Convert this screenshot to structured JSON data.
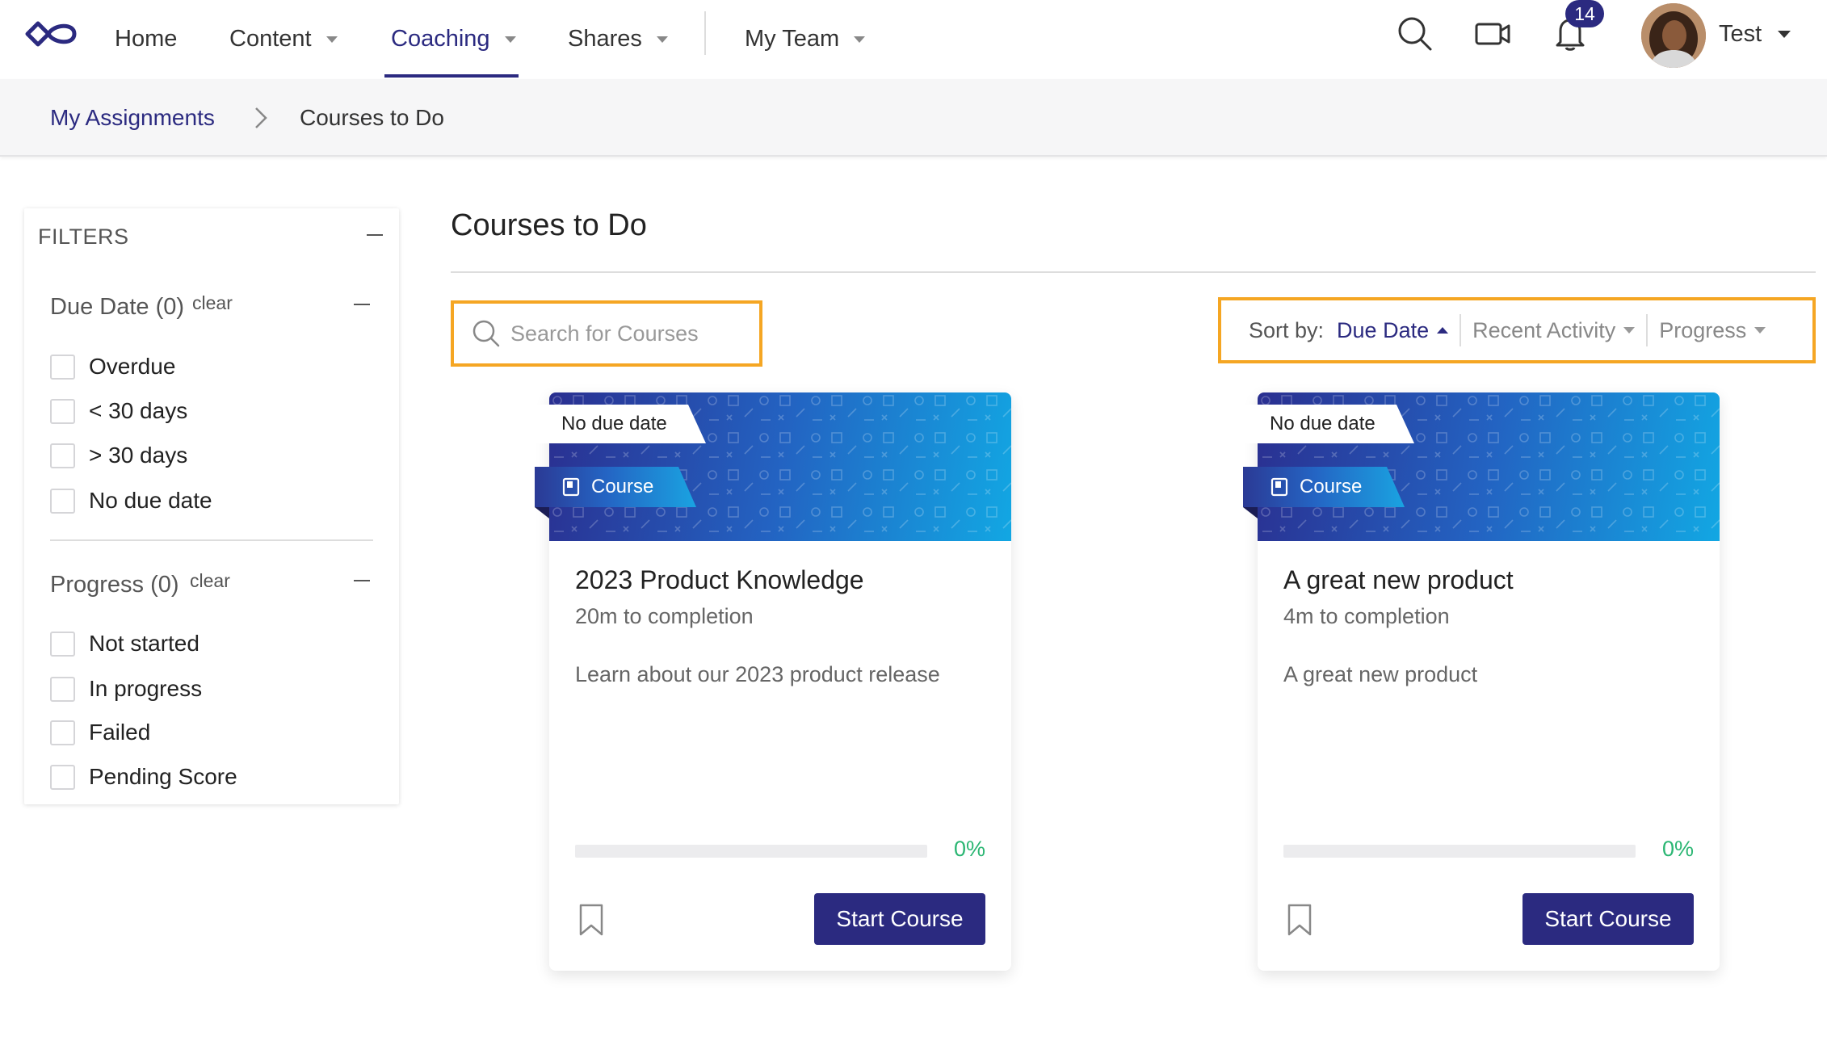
{
  "nav": {
    "items": [
      {
        "label": "Home"
      },
      {
        "label": "Content"
      },
      {
        "label": "Coaching"
      },
      {
        "label": "Shares"
      },
      {
        "label": "My Team"
      }
    ],
    "active": "Coaching",
    "notification_count": "14",
    "user_name": "Test",
    "icons": [
      "logo-infinity-icon",
      "search-icon",
      "video-camera-icon",
      "bell-icon"
    ]
  },
  "breadcrumb": {
    "parent": "My Assignments",
    "current": "Courses to Do"
  },
  "filters": {
    "title": "FILTERS",
    "due_date": {
      "title": "Due Date (0)",
      "clear": "clear",
      "options": [
        "Overdue",
        "< 30 days",
        "> 30 days",
        "No due date"
      ]
    },
    "progress": {
      "title": "Progress (0)",
      "clear": "clear",
      "options": [
        "Not started",
        "In progress",
        "Failed",
        "Pending Score"
      ]
    }
  },
  "main": {
    "title": "Courses to Do",
    "search_placeholder": "Search for Courses",
    "sort": {
      "label": "Sort by:",
      "options": [
        "Due Date",
        "Recent Activity",
        "Progress"
      ],
      "active": "Due Date"
    }
  },
  "cards": [
    {
      "due_tag": "No due date",
      "type_tag": "Course",
      "title": "2023 Product Knowledge",
      "duration": "20m to completion",
      "description": "Learn about our 2023 product release",
      "progress": 0,
      "progress_label": "0%",
      "button": "Start Course"
    },
    {
      "due_tag": "No due date",
      "type_tag": "Course",
      "title": "A great new product",
      "duration": "4m to completion",
      "description": "A great new product",
      "progress": 0,
      "progress_label": "0%",
      "button": "Start Course"
    }
  ],
  "colors": {
    "brand": "#2b2a80",
    "highlight": "#f5a623",
    "progress": "#2bb673",
    "banner_start": "#2a2f90",
    "banner_end": "#12a7e3"
  }
}
